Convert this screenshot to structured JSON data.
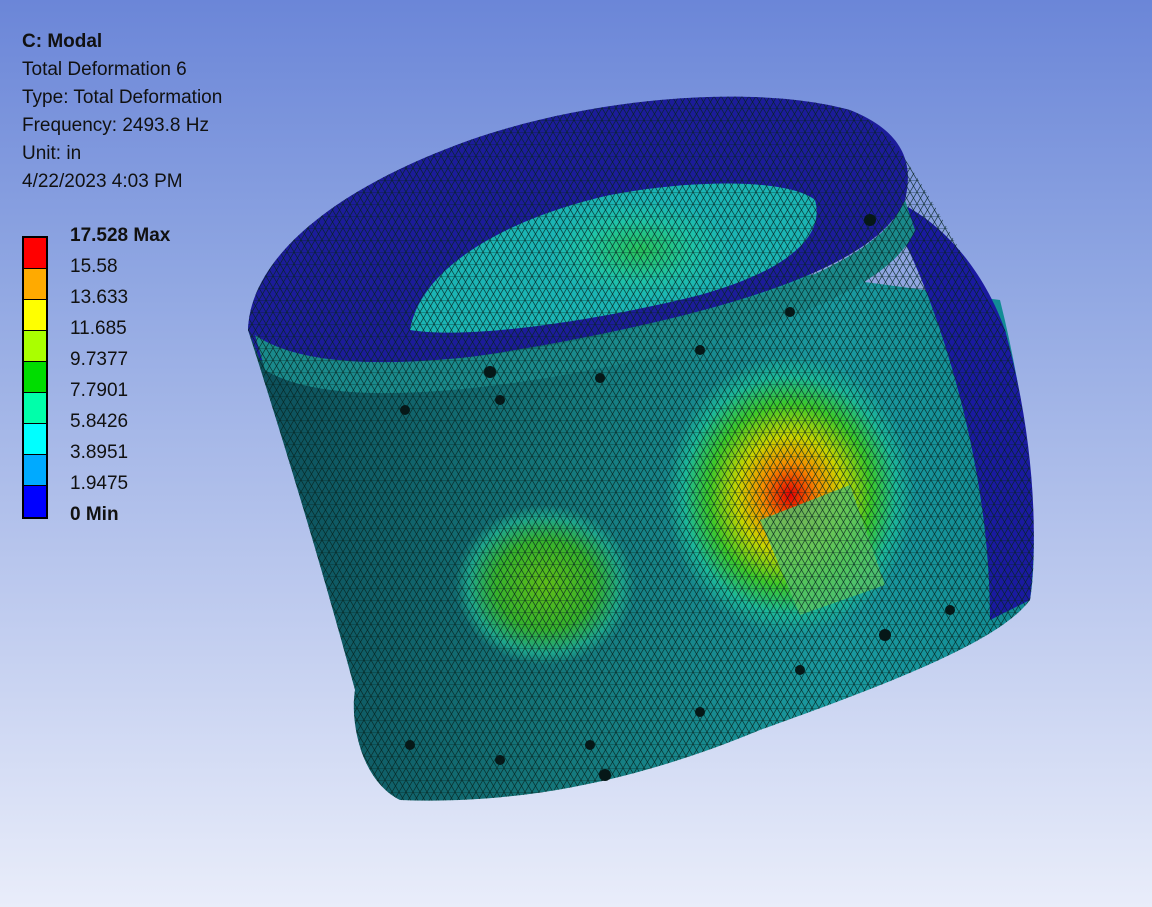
{
  "result": {
    "system": "C: Modal",
    "name": "Total Deformation 6",
    "type": "Type: Total Deformation",
    "frequency": "Frequency: 2493.8 Hz",
    "unit": "Unit: in",
    "timestamp": "4/22/2023 4:03 PM"
  },
  "legend": {
    "labels": [
      "17.528 Max",
      "15.58",
      "13.633",
      "11.685",
      "9.7377",
      "7.7901",
      "5.8426",
      "3.8951",
      "1.9475",
      "0 Min"
    ],
    "colors": [
      "#ff0000",
      "#ffaa00",
      "#ffff00",
      "#aaff00",
      "#00dd00",
      "#00ffaa",
      "#00ffff",
      "#00aaff",
      "#0000ff"
    ]
  },
  "model": {
    "shape": "cylindrical-housing",
    "colors": {
      "low": "#14148c",
      "mid": "#1aa6a6",
      "high": "#e80000",
      "mesh": "#0a1a1a"
    }
  }
}
